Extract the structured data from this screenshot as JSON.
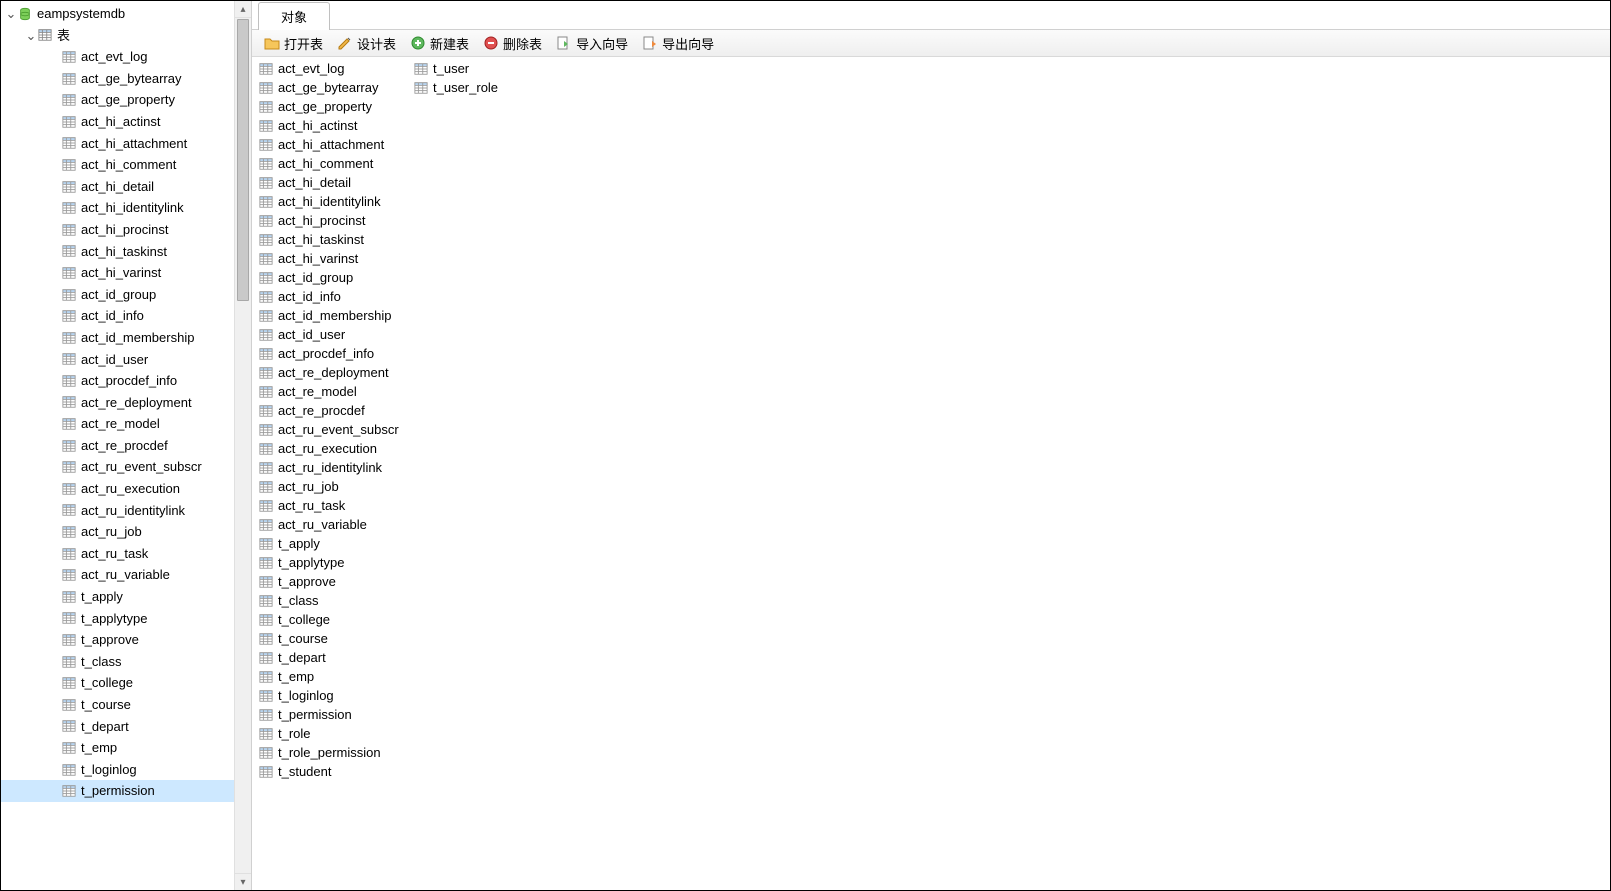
{
  "tree": {
    "db": "eampsystemdb",
    "tables_label": "表",
    "selected": "t_permission",
    "tables": [
      "act_evt_log",
      "act_ge_bytearray",
      "act_ge_property",
      "act_hi_actinst",
      "act_hi_attachment",
      "act_hi_comment",
      "act_hi_detail",
      "act_hi_identitylink",
      "act_hi_procinst",
      "act_hi_taskinst",
      "act_hi_varinst",
      "act_id_group",
      "act_id_info",
      "act_id_membership",
      "act_id_user",
      "act_procdef_info",
      "act_re_deployment",
      "act_re_model",
      "act_re_procdef",
      "act_ru_event_subscr",
      "act_ru_execution",
      "act_ru_identitylink",
      "act_ru_job",
      "act_ru_task",
      "act_ru_variable",
      "t_apply",
      "t_applytype",
      "t_approve",
      "t_class",
      "t_college",
      "t_course",
      "t_depart",
      "t_emp",
      "t_loginlog",
      "t_permission"
    ]
  },
  "tab": {
    "active": "对象"
  },
  "toolbar": {
    "open": "打开表",
    "design": "设计表",
    "new": "新建表",
    "delete": "删除表",
    "import": "导入向导",
    "export": "导出向导"
  },
  "list": {
    "col1": [
      "act_evt_log",
      "act_ge_bytearray",
      "act_ge_property",
      "act_hi_actinst",
      "act_hi_attachment",
      "act_hi_comment",
      "act_hi_detail",
      "act_hi_identitylink",
      "act_hi_procinst",
      "act_hi_taskinst",
      "act_hi_varinst",
      "act_id_group",
      "act_id_info",
      "act_id_membership",
      "act_id_user",
      "act_procdef_info",
      "act_re_deployment",
      "act_re_model",
      "act_re_procdef",
      "act_ru_event_subscr",
      "act_ru_execution",
      "act_ru_identitylink",
      "act_ru_job",
      "act_ru_task",
      "act_ru_variable",
      "t_apply",
      "t_applytype",
      "t_approve",
      "t_class",
      "t_college",
      "t_course",
      "t_depart",
      "t_emp",
      "t_loginlog",
      "t_permission",
      "t_role",
      "t_role_permission",
      "t_student"
    ],
    "col2": [
      "t_user",
      "t_user_role"
    ]
  }
}
